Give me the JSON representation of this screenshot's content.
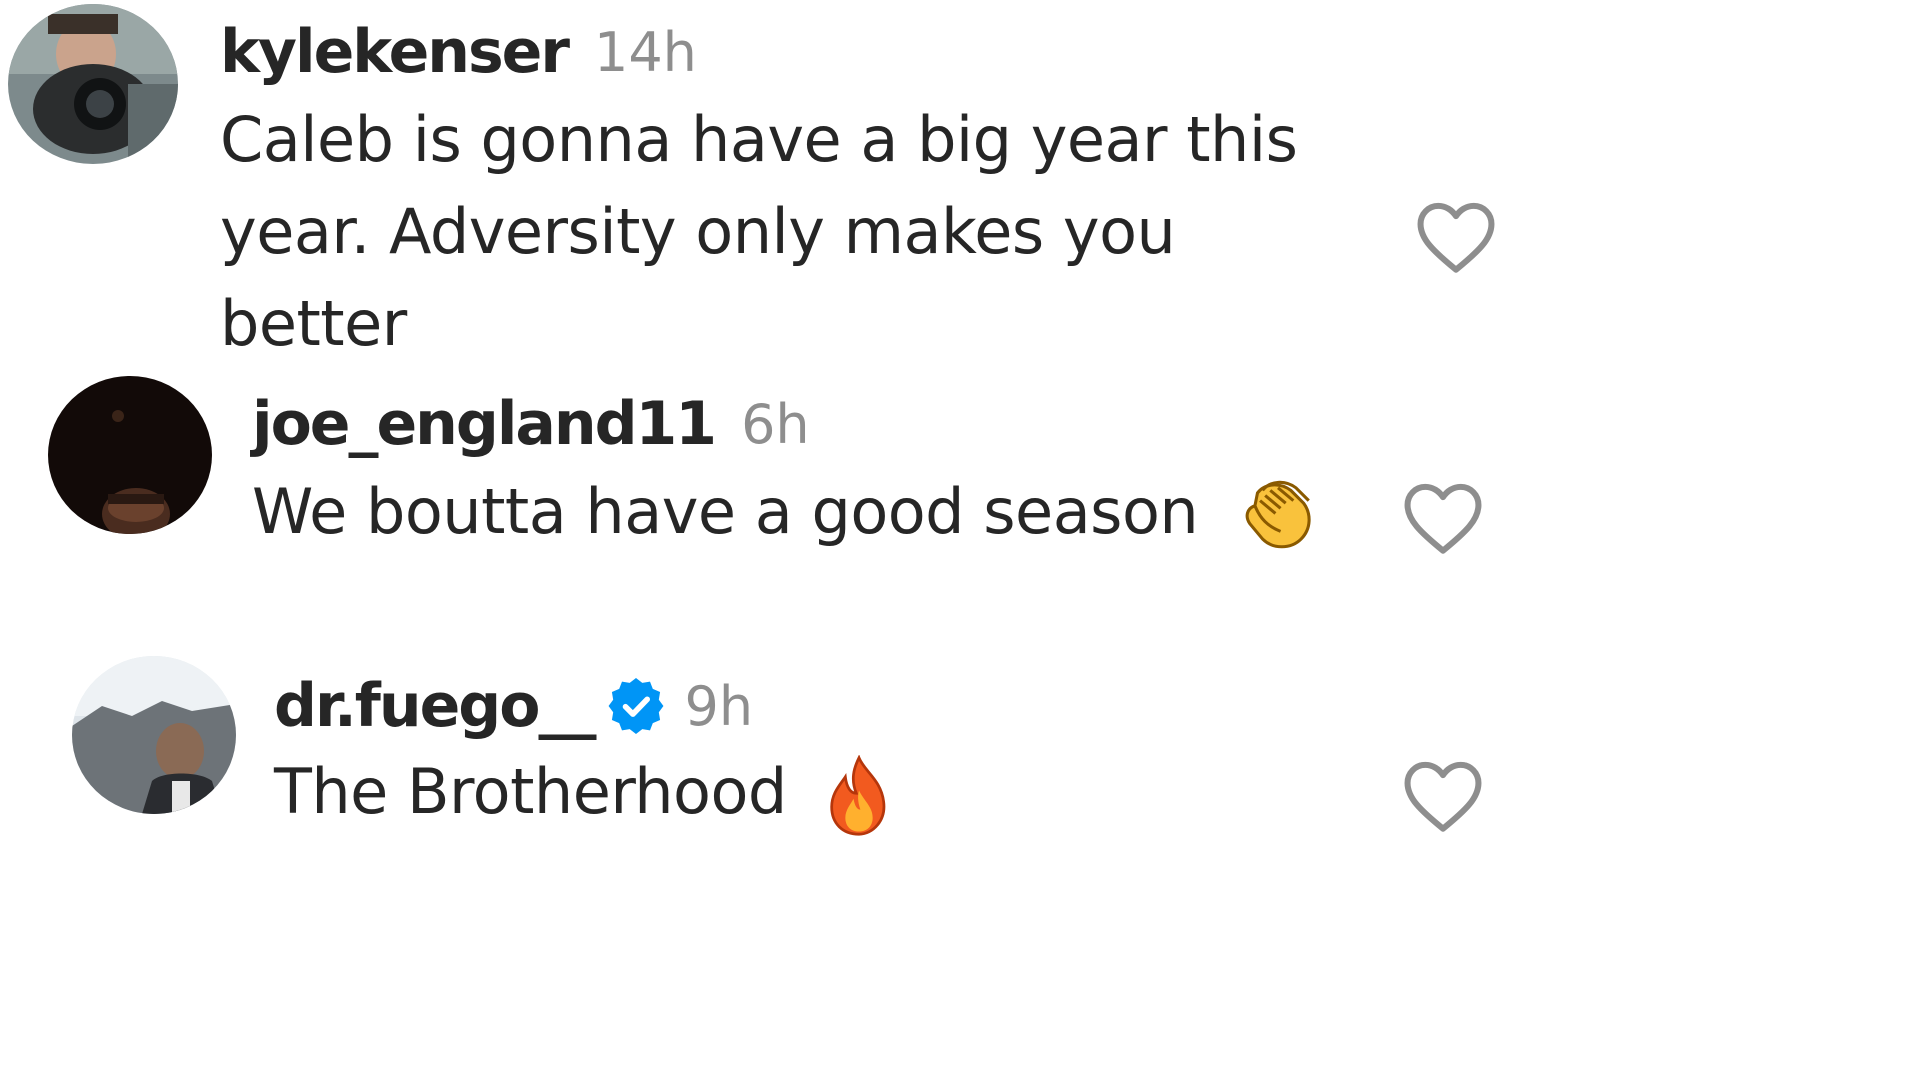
{
  "comments": [
    {
      "username": "kylekenser",
      "time": "14h",
      "text": "Caleb is gonna have a big year this year. Adversity only makes you better",
      "verified": false,
      "emoji": ""
    },
    {
      "username": "joe_england11",
      "time": "6h",
      "text": "We boutta have a good season",
      "verified": false,
      "emoji": "clapping-hands"
    },
    {
      "username": "dr.fuego__",
      "time": "9h",
      "text": "The Brotherhood",
      "verified": true,
      "emoji": "fire"
    }
  ],
  "icons": {
    "like": "heart-outline-icon",
    "verified": "verified-badge-icon"
  },
  "colors": {
    "username": "#262626",
    "timestamp": "#8e8e8e",
    "verified_badge": "#0095f6",
    "heart_outline": "#8e8e8e"
  }
}
